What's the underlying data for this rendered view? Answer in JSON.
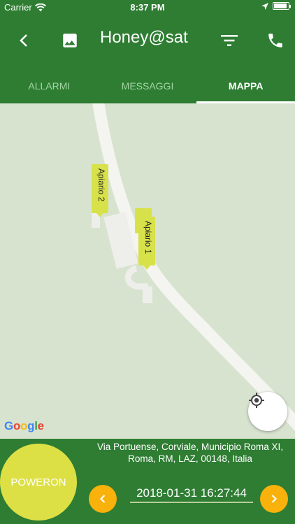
{
  "status_bar": {
    "carrier": "Carrier",
    "time": "8:37 PM"
  },
  "app_bar": {
    "title": "Honey@sat"
  },
  "tabs": [
    {
      "label": "ALLARMI",
      "active": false
    },
    {
      "label": "MESSAGGI",
      "active": false
    },
    {
      "label": "MAPPA",
      "active": true
    }
  ],
  "map": {
    "markers": [
      {
        "label": "Apiario 2"
      },
      {
        "label": "Apiario 1"
      }
    ],
    "attribution": "Google"
  },
  "bottom": {
    "power_label": "POWERON",
    "address": "Via Portuense, Corviale, Municipio Roma XI, Roma, RM, LAZ, 00148, Italia",
    "datetime": "2018-01-31 16:27:44"
  },
  "colors": {
    "primary": "#2e7d32",
    "tab_inactive": "#a5d6a7",
    "power": "#dde045",
    "nav": "#f9b10c",
    "marker": "#d7e24a",
    "map_bg": "#d7e3cf"
  }
}
